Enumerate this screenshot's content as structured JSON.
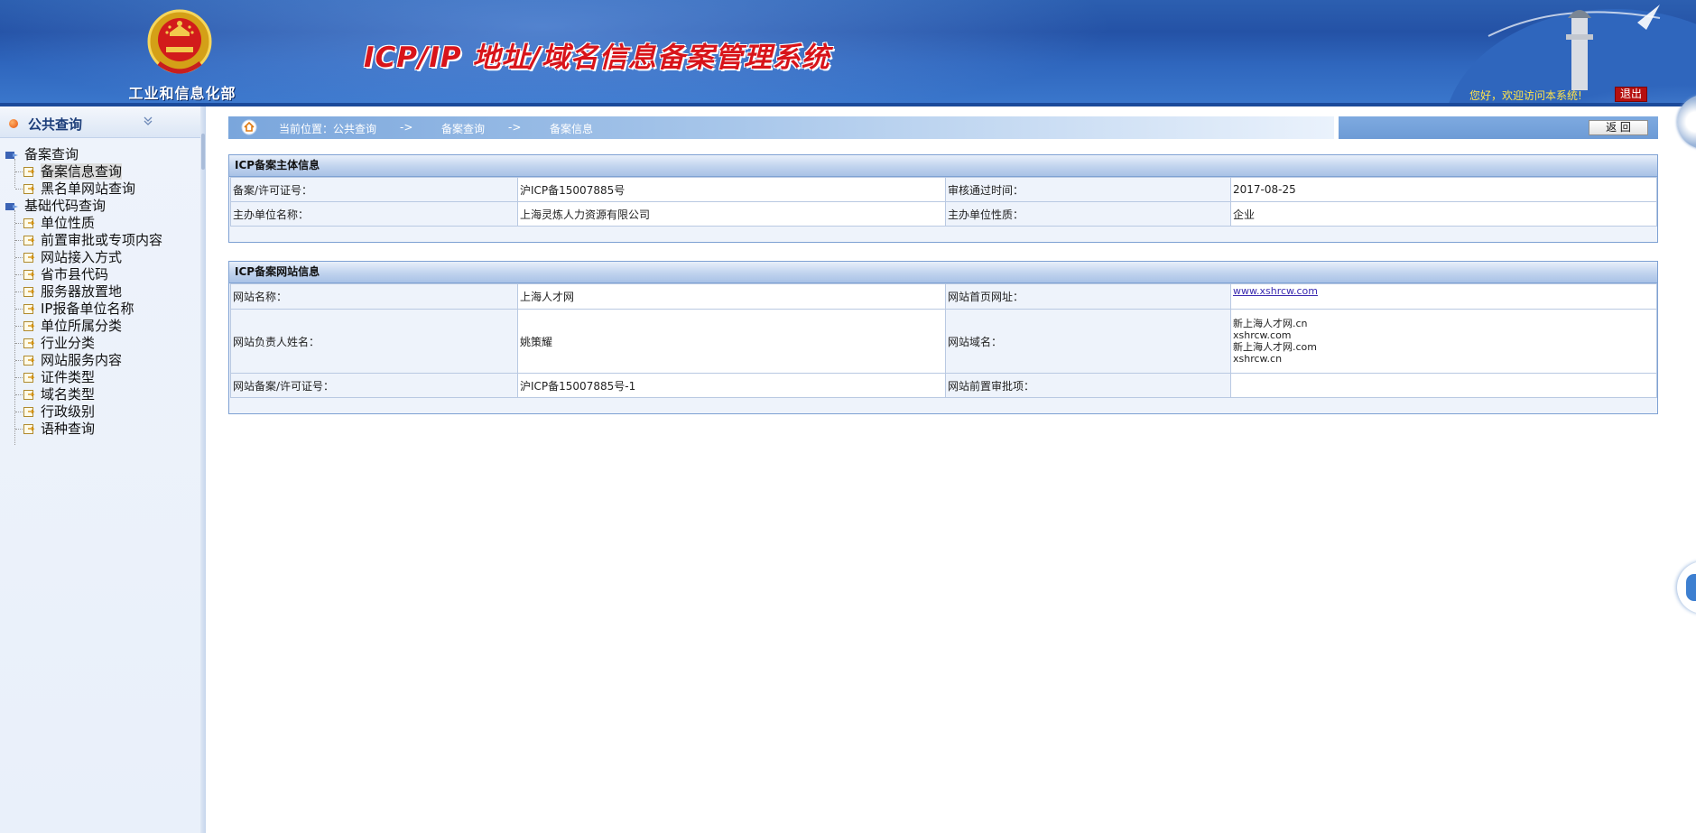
{
  "header": {
    "ministry_name": "工业和信息化部",
    "system_title": "ICP/IP 地址/域名信息备案管理系统",
    "welcome": "您好，欢迎访问本系统!",
    "logout_label": "退出"
  },
  "sidebar": {
    "title": "公共查询",
    "groups": [
      {
        "label": "备案查询",
        "items": [
          "备案信息查询",
          "黑名单网站查询"
        ]
      },
      {
        "label": "基础代码查询",
        "items": [
          "单位性质",
          "前置审批或专项内容",
          "网站接入方式",
          "省市县代码",
          "服务器放置地",
          "IP报备单位名称",
          "单位所属分类",
          "行业分类",
          "网站服务内容",
          "证件类型",
          "域名类型",
          "行政级别",
          "语种查询"
        ]
      }
    ],
    "selected_item": "备案信息查询"
  },
  "breadcrumb": {
    "prefix": "当前位置：公共查询",
    "arrow1": "->",
    "level2": "备案查询",
    "arrow2": "->",
    "level3": "备案信息"
  },
  "back_label": "返  回",
  "subject_panel": {
    "title": "ICP备案主体信息",
    "rows": [
      [
        "备案/许可证号：",
        "沪ICP备15007885号",
        "审核通过时间：",
        "2017-08-25"
      ],
      [
        "主办单位名称：",
        "上海灵炼人力资源有限公司",
        "主办单位性质：",
        "企业"
      ]
    ]
  },
  "website_panel": {
    "title": "ICP备案网站信息",
    "site_name_label": "网站名称：",
    "site_name": "上海人才网",
    "homepage_label": "网站首页网址：",
    "homepage": "www.xshrcw.com",
    "owner_label": "网站负责人姓名：",
    "owner": "姚策耀",
    "domain_label": "网站域名：",
    "domains": [
      "新上海人才网.cn",
      "xshrcw.com",
      "新上海人才网.com",
      "xshrcw.cn"
    ],
    "license_label": "网站备案/许可证号：",
    "license": "沪ICP备15007885号-1",
    "preapproval_label": "网站前置审批项：",
    "preapproval": ""
  }
}
